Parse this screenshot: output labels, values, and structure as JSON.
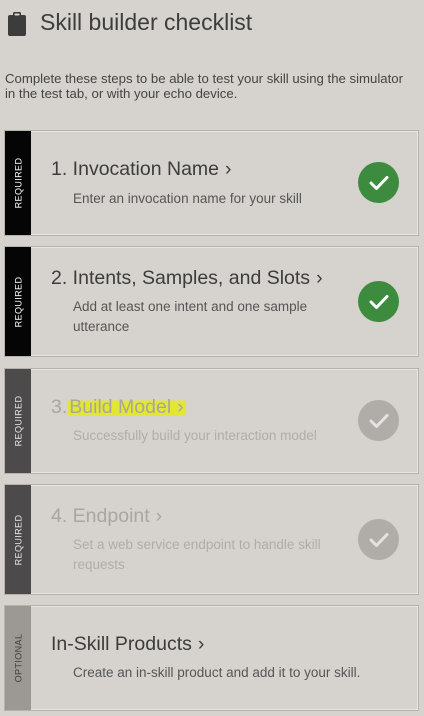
{
  "header": {
    "title": "Skill builder checklist",
    "icon": "clipboard-icon"
  },
  "intro": "Complete these steps to be able to test your skill using the simulator in the test tab, or with your echo device.",
  "colors": {
    "done": "#3c8b3e",
    "pending": "#b0ada9",
    "highlight": "#e2e635",
    "required_tag": "#050505"
  },
  "steps": [
    {
      "tag": "REQUIRED",
      "title": "1. Invocation Name",
      "chevron": "›",
      "desc": "Enter an invocation name for your skill",
      "status": "complete"
    },
    {
      "tag": "REQUIRED",
      "title": "2. Intents, Samples, and Slots",
      "chevron": "›",
      "desc": "Add at least one intent and one sample utterance",
      "status": "complete"
    },
    {
      "tag": "REQUIRED",
      "title_prefix": "3.",
      "title": "Build Model",
      "chevron": "›",
      "desc": "Successfully build your interaction model",
      "status": "incomplete",
      "highlighted": true
    },
    {
      "tag": "REQUIRED",
      "title": "4. Endpoint",
      "chevron": "›",
      "desc": "Set a web service endpoint to handle skill requests",
      "status": "incomplete"
    },
    {
      "tag": "OPTIONAL",
      "title": "In-Skill Products",
      "chevron": "›",
      "desc": "Create an in-skill product and add it to your skill."
    }
  ]
}
